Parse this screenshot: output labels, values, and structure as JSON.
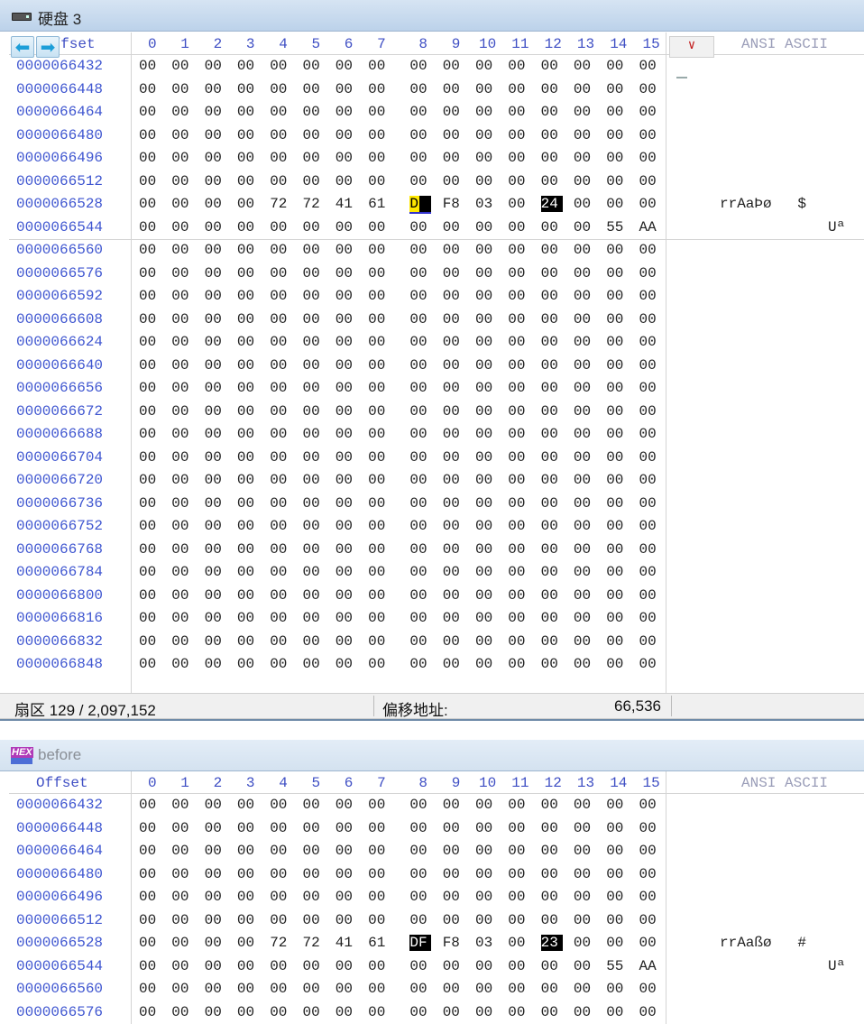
{
  "window1": {
    "title": "硬盘 3",
    "offset_header": "Offset",
    "ascii_header": "ANSI ASCII",
    "view_button": "∨",
    "nav_back_icon": "arrow-left-icon",
    "nav_forward_icon": "arrow-right-icon",
    "col_headers": [
      "0",
      "1",
      "2",
      "3",
      "4",
      "5",
      "6",
      "7",
      "8",
      "9",
      "10",
      "11",
      "12",
      "13",
      "14",
      "15"
    ],
    "rows": [
      {
        "addr": "0000066432",
        "bytes": [
          "00",
          "00",
          "00",
          "00",
          "00",
          "00",
          "00",
          "00",
          "00",
          "00",
          "00",
          "00",
          "00",
          "00",
          "00",
          "00"
        ],
        "ascii": ""
      },
      {
        "addr": "0000066448",
        "bytes": [
          "00",
          "00",
          "00",
          "00",
          "00",
          "00",
          "00",
          "00",
          "00",
          "00",
          "00",
          "00",
          "00",
          "00",
          "00",
          "00"
        ],
        "ascii": ""
      },
      {
        "addr": "0000066464",
        "bytes": [
          "00",
          "00",
          "00",
          "00",
          "00",
          "00",
          "00",
          "00",
          "00",
          "00",
          "00",
          "00",
          "00",
          "00",
          "00",
          "00"
        ],
        "ascii": ""
      },
      {
        "addr": "0000066480",
        "bytes": [
          "00",
          "00",
          "00",
          "00",
          "00",
          "00",
          "00",
          "00",
          "00",
          "00",
          "00",
          "00",
          "00",
          "00",
          "00",
          "00"
        ],
        "ascii": ""
      },
      {
        "addr": "0000066496",
        "bytes": [
          "00",
          "00",
          "00",
          "00",
          "00",
          "00",
          "00",
          "00",
          "00",
          "00",
          "00",
          "00",
          "00",
          "00",
          "00",
          "00"
        ],
        "ascii": ""
      },
      {
        "addr": "0000066512",
        "bytes": [
          "00",
          "00",
          "00",
          "00",
          "00",
          "00",
          "00",
          "00",
          "00",
          "00",
          "00",
          "00",
          "00",
          "00",
          "00",
          "00"
        ],
        "ascii": ""
      },
      {
        "addr": "0000066528",
        "bytes": [
          "00",
          "00",
          "00",
          "00",
          "72",
          "72",
          "41",
          "61",
          "DE",
          "F8",
          "03",
          "00",
          "24",
          "00",
          "00",
          "00"
        ],
        "ascii": "rrAaÞø   $"
      },
      {
        "addr": "0000066544",
        "bytes": [
          "00",
          "00",
          "00",
          "00",
          "00",
          "00",
          "00",
          "00",
          "00",
          "00",
          "00",
          "00",
          "00",
          "00",
          "55",
          "AA"
        ],
        "ascii": "Uª"
      },
      {
        "addr": "0000066560",
        "bytes": [
          "00",
          "00",
          "00",
          "00",
          "00",
          "00",
          "00",
          "00",
          "00",
          "00",
          "00",
          "00",
          "00",
          "00",
          "00",
          "00"
        ],
        "ascii": ""
      },
      {
        "addr": "0000066576",
        "bytes": [
          "00",
          "00",
          "00",
          "00",
          "00",
          "00",
          "00",
          "00",
          "00",
          "00",
          "00",
          "00",
          "00",
          "00",
          "00",
          "00"
        ],
        "ascii": ""
      },
      {
        "addr": "0000066592",
        "bytes": [
          "00",
          "00",
          "00",
          "00",
          "00",
          "00",
          "00",
          "00",
          "00",
          "00",
          "00",
          "00",
          "00",
          "00",
          "00",
          "00"
        ],
        "ascii": ""
      },
      {
        "addr": "0000066608",
        "bytes": [
          "00",
          "00",
          "00",
          "00",
          "00",
          "00",
          "00",
          "00",
          "00",
          "00",
          "00",
          "00",
          "00",
          "00",
          "00",
          "00"
        ],
        "ascii": ""
      },
      {
        "addr": "0000066624",
        "bytes": [
          "00",
          "00",
          "00",
          "00",
          "00",
          "00",
          "00",
          "00",
          "00",
          "00",
          "00",
          "00",
          "00",
          "00",
          "00",
          "00"
        ],
        "ascii": ""
      },
      {
        "addr": "0000066640",
        "bytes": [
          "00",
          "00",
          "00",
          "00",
          "00",
          "00",
          "00",
          "00",
          "00",
          "00",
          "00",
          "00",
          "00",
          "00",
          "00",
          "00"
        ],
        "ascii": ""
      },
      {
        "addr": "0000066656",
        "bytes": [
          "00",
          "00",
          "00",
          "00",
          "00",
          "00",
          "00",
          "00",
          "00",
          "00",
          "00",
          "00",
          "00",
          "00",
          "00",
          "00"
        ],
        "ascii": ""
      },
      {
        "addr": "0000066672",
        "bytes": [
          "00",
          "00",
          "00",
          "00",
          "00",
          "00",
          "00",
          "00",
          "00",
          "00",
          "00",
          "00",
          "00",
          "00",
          "00",
          "00"
        ],
        "ascii": ""
      },
      {
        "addr": "0000066688",
        "bytes": [
          "00",
          "00",
          "00",
          "00",
          "00",
          "00",
          "00",
          "00",
          "00",
          "00",
          "00",
          "00",
          "00",
          "00",
          "00",
          "00"
        ],
        "ascii": ""
      },
      {
        "addr": "0000066704",
        "bytes": [
          "00",
          "00",
          "00",
          "00",
          "00",
          "00",
          "00",
          "00",
          "00",
          "00",
          "00",
          "00",
          "00",
          "00",
          "00",
          "00"
        ],
        "ascii": ""
      },
      {
        "addr": "0000066720",
        "bytes": [
          "00",
          "00",
          "00",
          "00",
          "00",
          "00",
          "00",
          "00",
          "00",
          "00",
          "00",
          "00",
          "00",
          "00",
          "00",
          "00"
        ],
        "ascii": ""
      },
      {
        "addr": "0000066736",
        "bytes": [
          "00",
          "00",
          "00",
          "00",
          "00",
          "00",
          "00",
          "00",
          "00",
          "00",
          "00",
          "00",
          "00",
          "00",
          "00",
          "00"
        ],
        "ascii": ""
      },
      {
        "addr": "0000066752",
        "bytes": [
          "00",
          "00",
          "00",
          "00",
          "00",
          "00",
          "00",
          "00",
          "00",
          "00",
          "00",
          "00",
          "00",
          "00",
          "00",
          "00"
        ],
        "ascii": ""
      },
      {
        "addr": "0000066768",
        "bytes": [
          "00",
          "00",
          "00",
          "00",
          "00",
          "00",
          "00",
          "00",
          "00",
          "00",
          "00",
          "00",
          "00",
          "00",
          "00",
          "00"
        ],
        "ascii": ""
      },
      {
        "addr": "0000066784",
        "bytes": [
          "00",
          "00",
          "00",
          "00",
          "00",
          "00",
          "00",
          "00",
          "00",
          "00",
          "00",
          "00",
          "00",
          "00",
          "00",
          "00"
        ],
        "ascii": ""
      },
      {
        "addr": "0000066800",
        "bytes": [
          "00",
          "00",
          "00",
          "00",
          "00",
          "00",
          "00",
          "00",
          "00",
          "00",
          "00",
          "00",
          "00",
          "00",
          "00",
          "00"
        ],
        "ascii": ""
      },
      {
        "addr": "0000066816",
        "bytes": [
          "00",
          "00",
          "00",
          "00",
          "00",
          "00",
          "00",
          "00",
          "00",
          "00",
          "00",
          "00",
          "00",
          "00",
          "00",
          "00"
        ],
        "ascii": ""
      },
      {
        "addr": "0000066832",
        "bytes": [
          "00",
          "00",
          "00",
          "00",
          "00",
          "00",
          "00",
          "00",
          "00",
          "00",
          "00",
          "00",
          "00",
          "00",
          "00",
          "00"
        ],
        "ascii": ""
      },
      {
        "addr": "0000066848",
        "bytes": [
          "00",
          "00",
          "00",
          "00",
          "00",
          "00",
          "00",
          "00",
          "00",
          "00",
          "00",
          "00",
          "00",
          "00",
          "00",
          "00"
        ],
        "ascii": ""
      }
    ],
    "highlight": {
      "row": 6,
      "cols": [
        8,
        12
      ],
      "cursor_col": 8
    },
    "status": {
      "sector": "扇区 129 / 2,097,152",
      "offset_label": "偏移地址:",
      "offset_value": "66,536"
    }
  },
  "window2": {
    "title": "before",
    "offset_header": "Offset",
    "ascii_header": "ANSI ASCII",
    "icon": "hex-editor-icon",
    "col_headers": [
      "0",
      "1",
      "2",
      "3",
      "4",
      "5",
      "6",
      "7",
      "8",
      "9",
      "10",
      "11",
      "12",
      "13",
      "14",
      "15"
    ],
    "rows": [
      {
        "addr": "0000066432",
        "bytes": [
          "00",
          "00",
          "00",
          "00",
          "00",
          "00",
          "00",
          "00",
          "00",
          "00",
          "00",
          "00",
          "00",
          "00",
          "00",
          "00"
        ],
        "ascii": ""
      },
      {
        "addr": "0000066448",
        "bytes": [
          "00",
          "00",
          "00",
          "00",
          "00",
          "00",
          "00",
          "00",
          "00",
          "00",
          "00",
          "00",
          "00",
          "00",
          "00",
          "00"
        ],
        "ascii": ""
      },
      {
        "addr": "0000066464",
        "bytes": [
          "00",
          "00",
          "00",
          "00",
          "00",
          "00",
          "00",
          "00",
          "00",
          "00",
          "00",
          "00",
          "00",
          "00",
          "00",
          "00"
        ],
        "ascii": ""
      },
      {
        "addr": "0000066480",
        "bytes": [
          "00",
          "00",
          "00",
          "00",
          "00",
          "00",
          "00",
          "00",
          "00",
          "00",
          "00",
          "00",
          "00",
          "00",
          "00",
          "00"
        ],
        "ascii": ""
      },
      {
        "addr": "0000066496",
        "bytes": [
          "00",
          "00",
          "00",
          "00",
          "00",
          "00",
          "00",
          "00",
          "00",
          "00",
          "00",
          "00",
          "00",
          "00",
          "00",
          "00"
        ],
        "ascii": ""
      },
      {
        "addr": "0000066512",
        "bytes": [
          "00",
          "00",
          "00",
          "00",
          "00",
          "00",
          "00",
          "00",
          "00",
          "00",
          "00",
          "00",
          "00",
          "00",
          "00",
          "00"
        ],
        "ascii": ""
      },
      {
        "addr": "0000066528",
        "bytes": [
          "00",
          "00",
          "00",
          "00",
          "72",
          "72",
          "41",
          "61",
          "DF",
          "F8",
          "03",
          "00",
          "23",
          "00",
          "00",
          "00"
        ],
        "ascii": "rrAaßø   #"
      },
      {
        "addr": "0000066544",
        "bytes": [
          "00",
          "00",
          "00",
          "00",
          "00",
          "00",
          "00",
          "00",
          "00",
          "00",
          "00",
          "00",
          "00",
          "00",
          "55",
          "AA"
        ],
        "ascii": "Uª"
      },
      {
        "addr": "0000066560",
        "bytes": [
          "00",
          "00",
          "00",
          "00",
          "00",
          "00",
          "00",
          "00",
          "00",
          "00",
          "00",
          "00",
          "00",
          "00",
          "00",
          "00"
        ],
        "ascii": ""
      },
      {
        "addr": "0000066576",
        "bytes": [
          "00",
          "00",
          "00",
          "00",
          "00",
          "00",
          "00",
          "00",
          "00",
          "00",
          "00",
          "00",
          "00",
          "00",
          "00",
          "00"
        ],
        "ascii": ""
      }
    ],
    "highlight": {
      "row": 6,
      "cols": [
        8,
        12
      ]
    }
  }
}
